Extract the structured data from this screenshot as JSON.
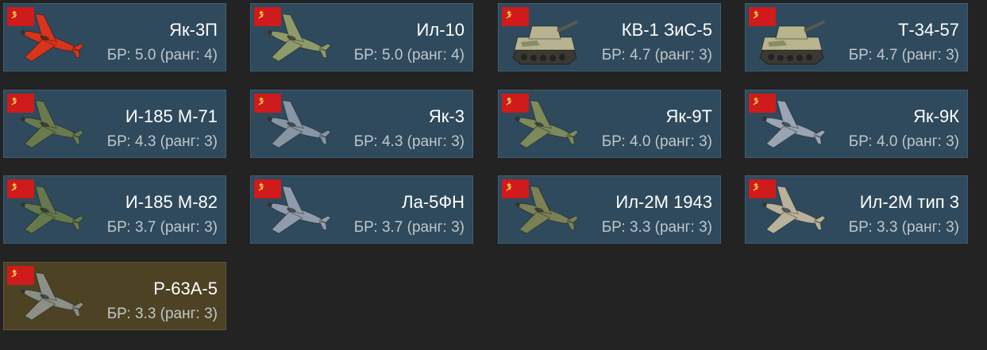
{
  "vehicles": [
    {
      "name": "Як-3П",
      "br": "БР: 5.0 (ранг: 4)",
      "kind": "plane",
      "icon": "fighter-plane-icon",
      "color": "#d8351d",
      "premium": false
    },
    {
      "name": "Ил-10",
      "br": "БР: 5.0 (ранг: 4)",
      "kind": "plane",
      "icon": "attacker-plane-icon",
      "color": "#8f9a6a",
      "premium": false
    },
    {
      "name": "КВ-1 ЗиС-5",
      "br": "БР: 4.7 (ранг: 3)",
      "kind": "tank",
      "icon": "heavy-tank-icon",
      "color": "#b7b391",
      "premium": false
    },
    {
      "name": "Т-34-57",
      "br": "БР: 4.7 (ранг: 3)",
      "kind": "tank",
      "icon": "medium-tank-icon",
      "color": "#b8b48d",
      "premium": false
    },
    {
      "name": "И-185 М-71",
      "br": "БР: 4.3 (ранг: 3)",
      "kind": "plane",
      "icon": "fighter-plane-icon",
      "color": "#6a7a4e",
      "premium": false
    },
    {
      "name": "Як-3",
      "br": "БР: 4.3 (ранг: 3)",
      "kind": "plane",
      "icon": "fighter-plane-icon",
      "color": "#8895a3",
      "premium": false
    },
    {
      "name": "Як-9Т",
      "br": "БР: 4.0 (ранг: 3)",
      "kind": "plane",
      "icon": "fighter-plane-icon",
      "color": "#7d8a5c",
      "premium": false
    },
    {
      "name": "Як-9К",
      "br": "БР: 4.0 (ранг: 3)",
      "kind": "plane",
      "icon": "fighter-plane-icon",
      "color": "#9aa4b2",
      "premium": false
    },
    {
      "name": "И-185 М-82",
      "br": "БР: 3.7 (ранг: 3)",
      "kind": "plane",
      "icon": "fighter-plane-icon",
      "color": "#66794c",
      "premium": false
    },
    {
      "name": "Ла-5ФН",
      "br": "БР: 3.7 (ранг: 3)",
      "kind": "plane",
      "icon": "fighter-plane-icon",
      "color": "#909cab",
      "premium": false
    },
    {
      "name": "Ил-2М 1943",
      "br": "БР: 3.3 (ранг: 3)",
      "kind": "plane",
      "icon": "attacker-plane-icon",
      "color": "#7c8055",
      "premium": false
    },
    {
      "name": "Ил-2М тип 3",
      "br": "БР: 3.3 (ранг: 3)",
      "kind": "plane",
      "icon": "attacker-plane-icon",
      "color": "#b9b29a",
      "premium": false
    },
    {
      "name": "Р-63А-5",
      "br": "БР: 3.3 (ранг: 3)",
      "kind": "plane",
      "icon": "fighter-plane-icon",
      "color": "#8c8f85",
      "premium": true
    }
  ],
  "flag_icon": "ussr-flag-icon"
}
